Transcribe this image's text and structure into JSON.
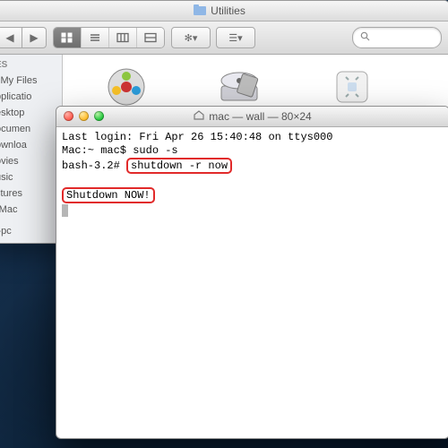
{
  "finder": {
    "title": "Utilities",
    "nav": {
      "back": "◀",
      "forward": "▶"
    },
    "tools": {
      "action": "✻▾",
      "arrange": "☰▾"
    },
    "search_placeholder": "",
    "sidebar": {
      "header": "ES",
      "items": [
        "l My Files",
        "pplicatio",
        "esktop",
        "ocumen",
        "ownloa",
        "ovies",
        "usic",
        "ctures",
        "rMac",
        "",
        "l-pc"
      ]
    },
    "apps": [
      {
        "name": "DigitalColor Meter"
      },
      {
        "name": "Disk Utility"
      },
      {
        "name": "Grab"
      }
    ]
  },
  "terminal": {
    "title": "mac — wall — 80×24",
    "lines": {
      "l1": "Last login: Fri Apr 26 15:40:48 on ttys000",
      "l2a": "Mac:~ mac$ ",
      "l2b": "sudo -s",
      "l3a": "bash-3.2# ",
      "l3b": "shutdown -r now",
      "l5": "Shutdown NOW!"
    }
  }
}
